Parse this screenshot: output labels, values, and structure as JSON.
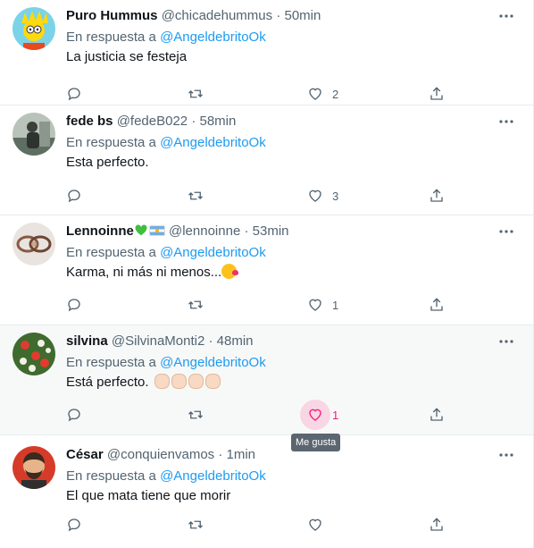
{
  "reply_prefix": "En respuesta a",
  "tweets": [
    {
      "name": "Puro Hummus",
      "handle": "@chicadehummus",
      "dot": "·",
      "time": "50min",
      "reply_to": "@AngeldebritoOk",
      "text": "La justicia se festeja",
      "likes": "2",
      "avatar_icon": "lisa-simpson-avatar"
    },
    {
      "name": "fede bs",
      "handle": "@fedeB022",
      "dot": "·",
      "time": "58min",
      "reply_to": "@AngeldebritoOk",
      "text": "Esta perfecto.",
      "likes": "3",
      "avatar_icon": "person-photo-avatar"
    },
    {
      "name": "Lennoinne",
      "name_emoji": "💚",
      "handle": "@lennoinne",
      "dot": "·",
      "time": "53min",
      "reply_to": "@AngeldebritoOk",
      "text": "Karma, ni más ni menos...",
      "likes": "1",
      "avatar_icon": "bracelet-photo-avatar"
    },
    {
      "name": "silvina",
      "handle": "@SilvinaMonti2",
      "dot": "·",
      "time": "48min",
      "reply_to": "@AngeldebritoOk",
      "text": "Está perfecto.",
      "likes": "1",
      "avatar_icon": "salad-photo-avatar"
    },
    {
      "name": "César",
      "handle": "@conquienvamos",
      "dot": "·",
      "time": "1min",
      "reply_to": "@AngeldebritoOk",
      "text": "El que mata tiene que morir",
      "likes": "",
      "avatar_icon": "cartoon-man-avatar"
    }
  ],
  "tooltip": "Me gusta",
  "colors": {
    "link": "#1d9bf0",
    "muted": "#536471",
    "like_active": "#f91880",
    "hover_bg": "#f7f9f9"
  }
}
